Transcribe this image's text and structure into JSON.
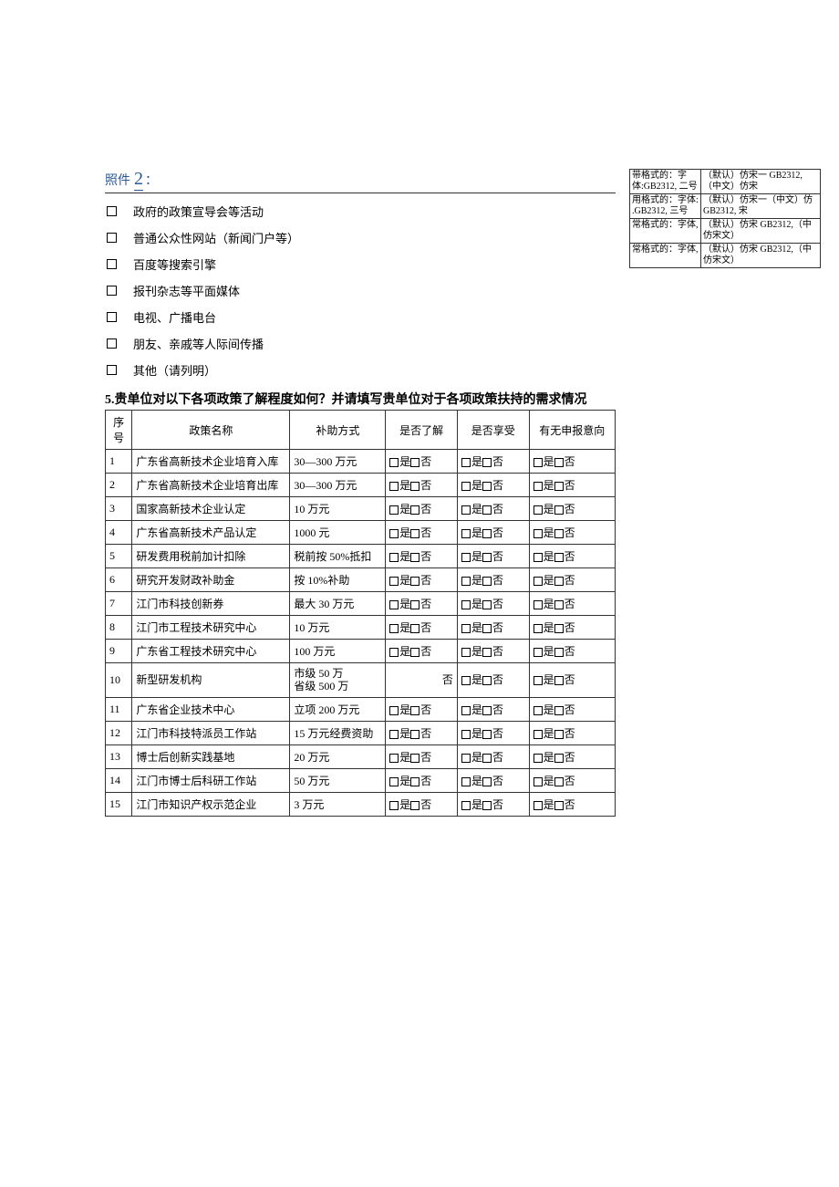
{
  "attachment": {
    "label": "照件",
    "num": "2",
    "colon": "："
  },
  "options": [
    "政府的政策宣导会等活动",
    "普通公众性网站（新闻门户等）",
    "百度等搜索引擎",
    "报刊杂志等平面媒体",
    "电视、广播电台",
    "朋友、亲戚等人际间传播",
    "其他（请列明）"
  ],
  "question": "5.贵单位对以下各项政策了解程度如何？并请填写贵单位对于各项政策扶持的需求情况",
  "headers": [
    "序号",
    "政策名称",
    "补助方式",
    "是否了解",
    "是否享受",
    "有无申报意向"
  ],
  "yn": {
    "yes": "是",
    "no": "否",
    "noOnly": "否"
  },
  "rows": [
    {
      "sn": "1",
      "name": "广东省高新技术企业培育入库",
      "sub": "30—300 万元",
      "c1": "yn",
      "c2": "yn",
      "c3": "yn"
    },
    {
      "sn": "2",
      "name": "广东省高新技术企业培育出库",
      "sub": "30—300 万元",
      "c1": "yn",
      "c2": "yn",
      "c3": "yn"
    },
    {
      "sn": "3",
      "name": "国家高新技术企业认定",
      "sub": "10 万元",
      "c1": "yn",
      "c2": "yn",
      "c3": "yn"
    },
    {
      "sn": "4",
      "name": "广东省高新技术产品认定",
      "sub": "1000 元",
      "c1": "yn",
      "c2": "yn",
      "c3": "yn"
    },
    {
      "sn": "5",
      "name": "研发费用税前加计扣除",
      "sub": "税前按 50%抵扣",
      "c1": "yn",
      "c2": "yn",
      "c3": "yn"
    },
    {
      "sn": "6",
      "name": "研究开发财政补助金",
      "sub": "按 10%补助",
      "c1": "yn",
      "c2": "yn",
      "c3": "yn"
    },
    {
      "sn": "7",
      "name": "江门市科技创新券",
      "sub": "最大 30 万元",
      "c1": "yn",
      "c2": "yn",
      "c3": "yn"
    },
    {
      "sn": "8",
      "name": "江门市工程技术研究中心",
      "sub": "10 万元",
      "c1": "yn",
      "c2": "yn",
      "c3": "yn"
    },
    {
      "sn": "9",
      "name": "广东省工程技术研究中心",
      "sub": "100 万元",
      "c1": "yn",
      "c2": "yn",
      "c3": "yn"
    },
    {
      "sn": "10",
      "name": "新型研发机构",
      "sub": "市级 50 万\n省级 500 万",
      "c1": "no",
      "c2": "yn",
      "c3": "yn"
    },
    {
      "sn": "11",
      "name": "广东省企业技术中心",
      "sub": "立项 200 万元",
      "c1": "yn",
      "c2": "yn",
      "c3": "yn"
    },
    {
      "sn": "12",
      "name": "江门市科技特派员工作站",
      "sub": "15 万元经费资助",
      "c1": "yn",
      "c2": "yn",
      "c3": "yn"
    },
    {
      "sn": "13",
      "name": "博士后创新实践基地",
      "sub": "20 万元",
      "c1": "yn",
      "c2": "yn",
      "c3": "yn"
    },
    {
      "sn": "14",
      "name": "江门市博士后科研工作站",
      "sub": "50 万元",
      "c1": "yn",
      "c2": "yn",
      "c3": "yn"
    },
    {
      "sn": "15",
      "name": "江门市知识产权示范企业",
      "sub": "3 万元",
      "c1": "yn",
      "c2": "yn",
      "c3": "yn"
    }
  ],
  "side": [
    {
      "l": "带格式的：字体:GB2312, 二号",
      "r": "（默认）仿宋一 GB2312,（中文）仿宋"
    },
    {
      "l": "用格式的：字体: .GB2312, 三号",
      "r": "（默认）仿宋一（中文）仿 GB2312, 宋"
    },
    {
      "l": "常格式的：字体,",
      "r": "（默认）仿宋 GB2312,（中 仿宋文）"
    },
    {
      "l": "常格式的：字体,",
      "r": "（默认）仿宋 GB2312,（中 仿宋文）"
    }
  ]
}
